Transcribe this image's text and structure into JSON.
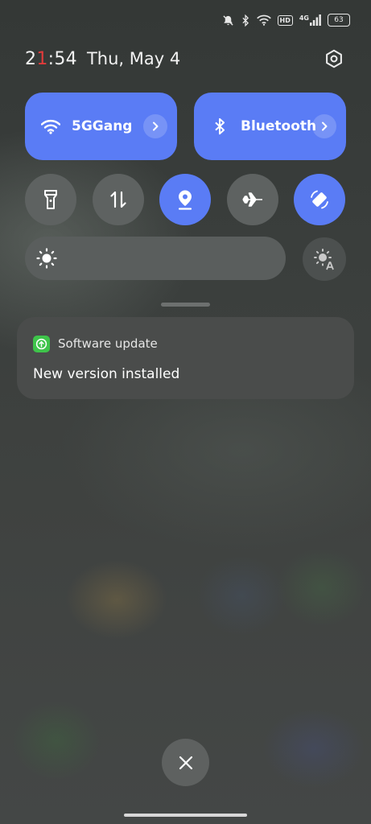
{
  "status_bar": {
    "icons": [
      "mute-icon",
      "bluetooth-icon",
      "wifi-icon",
      "hd-icon",
      "4g-signal-icon",
      "battery-icon"
    ],
    "hd_badge": "HD",
    "network_type": "4G",
    "battery_level": "63"
  },
  "header": {
    "time_prefix": "2",
    "time_accent": "1",
    "time_suffix": ":54",
    "date": "Thu, May 4"
  },
  "tiles": {
    "wifi": {
      "label": "5GGang",
      "icon": "wifi-icon",
      "active": true
    },
    "bluetooth": {
      "label": "Bluetooth",
      "icon": "bluetooth-icon",
      "active": true
    }
  },
  "toggles": [
    {
      "icon": "flashlight-icon",
      "active": false
    },
    {
      "icon": "mobile-data-icon",
      "active": false
    },
    {
      "icon": "location-icon",
      "active": true
    },
    {
      "icon": "airplane-icon",
      "active": false
    },
    {
      "icon": "auto-rotate-icon",
      "active": true
    }
  ],
  "brightness": {
    "level_fraction": 0.0,
    "auto_icon": "auto-brightness-icon"
  },
  "notification": {
    "app_name": "Software update",
    "app_icon": "update-icon",
    "message": "New version installed"
  },
  "colors": {
    "accent": "#5a7cf5",
    "tile_inactive": "#5e6261",
    "notification_bg": "#4a4c4b",
    "clock_accent": "#e23b3b",
    "app_icon_green": "#3ec44a"
  }
}
